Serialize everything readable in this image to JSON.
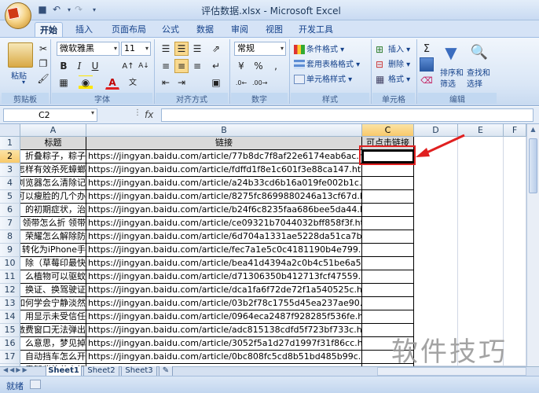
{
  "window": {
    "title": "评估数据.xlsx - Microsoft Excel"
  },
  "ribbon_tabs": [
    "开始",
    "插入",
    "页面布局",
    "公式",
    "数据",
    "审阅",
    "视图",
    "开发工具"
  ],
  "ribbon": {
    "clipboard": {
      "paste_label": "粘贴",
      "group_label": "剪贴板"
    },
    "font": {
      "name": "微软雅黑",
      "size": "11",
      "group_label": "字体"
    },
    "alignment": {
      "group_label": "对齐方式"
    },
    "number": {
      "format": "常规",
      "group_label": "数字",
      "percent": "%",
      "comma": ","
    },
    "styles": {
      "conditional": "条件格式",
      "table": "套用表格格式",
      "cell_styles": "单元格样式",
      "group_label": "样式"
    },
    "cells": {
      "insert": "插入",
      "delete": "删除",
      "format": "格式",
      "group_label": "单元格"
    },
    "editing": {
      "sort_filter_1": "排序和",
      "sort_filter_2": "筛选",
      "find_1": "查找和",
      "find_2": "选择",
      "group_label": "编辑"
    }
  },
  "formula_bar": {
    "name_box": "C2",
    "fx": "fx",
    "value": ""
  },
  "columns": [
    "A",
    "B",
    "C",
    "D",
    "E",
    "F"
  ],
  "rows": [
    "1",
    "2",
    "3",
    "4",
    "5",
    "6",
    "7",
    "8",
    "9",
    "10",
    "11",
    "12",
    "13",
    "14",
    "15",
    "16",
    "17",
    "18"
  ],
  "table": {
    "headers": [
      "标题",
      "链接",
      "可点击链接"
    ],
    "titles": [
      "折叠粽子，粽子",
      "怎样有效杀死蟑螂",
      "浏览器怎么清除记",
      "可以瘦脸的几个办",
      "的初期症状，治",
      "领带怎么折 领带",
      "荣耀怎么解除防",
      "转化为iPhone手",
      "除（草莓印最快",
      "么植物可以驱蚊",
      "换证、换驾驶证",
      "如何学会宁静淡然",
      "用显示未受信任",
      "激费窗口无法弹出",
      "么意思，梦见掉",
      "自动挡车怎么开",
      "露腿背的什么好"
    ],
    "links": [
      "https://jingyan.baidu.com/article/77b8dc7f8af22e6174eab6ac.html",
      "https://jingyan.baidu.com/article/fdffd1f8e1c601f3e88ca147.html",
      "https://jingyan.baidu.com/article/a24b33cd6b16a019fe002b1c.html",
      "https://jingyan.baidu.com/article/8275fc8699880246a13cf67d.html",
      "https://jingyan.baidu.com/article/b24f6c8235faa686bee5da44.html",
      "https://jingyan.baidu.com/article/ce09321b7044032bff858f3f.html",
      "https://jingyan.baidu.com/article/6d704a1331ae5228da51ca7b.html",
      "https://jingyan.baidu.com/article/fec7a1e5c0c4181190b4e799.html",
      "https://jingyan.baidu.com/article/bea41d4394a2c0b4c51be6a5.html",
      "https://jingyan.baidu.com/article/d71306350b412713fcf47559.html",
      "https://jingyan.baidu.com/article/dca1fa6f72de72f1a540525c.html",
      "https://jingyan.baidu.com/article/03b2f78c1755d45ea237ae90.html",
      "https://jingyan.baidu.com/article/0964eca2487f928285f536fe.html",
      "https://jingyan.baidu.com/article/adc815138cdfd5f723bf733c.html",
      "https://jingyan.baidu.com/article/3052f5a1d27d1997f31f86cc.html",
      "https://jingyan.baidu.com/article/0bc808fc5cd8b51bd485b99c.html",
      "https://jingyan.baidu.com/article/9f63fb91b0c8d8c8400f0e26.html"
    ]
  },
  "sheets": [
    "Sheet1",
    "Sheet2",
    "Sheet3"
  ],
  "status": "就绪",
  "watermark": "软件技巧",
  "colors": {
    "ribbon": "#d5e3f6",
    "header_fill": "#d9d9d9",
    "highlight": "#e02020"
  }
}
